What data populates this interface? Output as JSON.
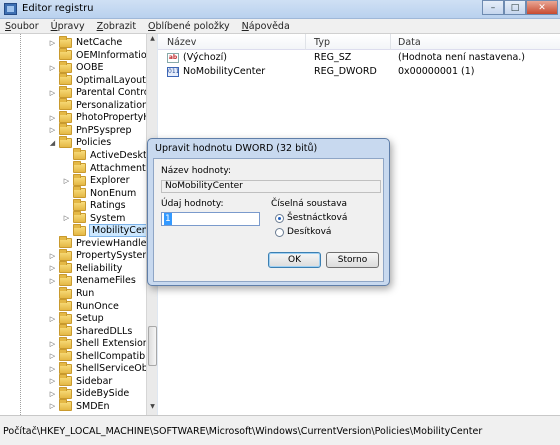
{
  "window": {
    "title": "Editor registru",
    "minimize": "–",
    "maximize": "□",
    "close": "✕"
  },
  "menu": [
    "Soubor",
    "Úpravy",
    "Zobrazit",
    "Oblíbené položky",
    "Nápověda"
  ],
  "tree": [
    {
      "label": "NetCache",
      "indent": 1,
      "expander": "▷"
    },
    {
      "label": "OEMInformation",
      "indent": 1,
      "expander": ""
    },
    {
      "label": "OOBE",
      "indent": 1,
      "expander": "▷"
    },
    {
      "label": "OptimalLayout",
      "indent": 1,
      "expander": ""
    },
    {
      "label": "Parental Controls",
      "indent": 1,
      "expander": "▷"
    },
    {
      "label": "Personalization",
      "indent": 1,
      "expander": ""
    },
    {
      "label": "PhotoPropertyHand",
      "indent": 1,
      "expander": "▷"
    },
    {
      "label": "PnPSysprep",
      "indent": 1,
      "expander": "▷"
    },
    {
      "label": "Policies",
      "indent": 1,
      "expander": "◢"
    },
    {
      "label": "ActiveDesktop",
      "indent": 2,
      "expander": ""
    },
    {
      "label": "Attachments",
      "indent": 2,
      "expander": ""
    },
    {
      "label": "Explorer",
      "indent": 2,
      "expander": "▷"
    },
    {
      "label": "NonEnum",
      "indent": 2,
      "expander": ""
    },
    {
      "label": "Ratings",
      "indent": 2,
      "expander": ""
    },
    {
      "label": "System",
      "indent": 2,
      "expander": "▷"
    },
    {
      "label": "MobilityCenter",
      "indent": 2,
      "expander": "",
      "selected": true
    },
    {
      "label": "PreviewHandlers",
      "indent": 1,
      "expander": ""
    },
    {
      "label": "PropertySystem",
      "indent": 1,
      "expander": "▷"
    },
    {
      "label": "Reliability",
      "indent": 1,
      "expander": "▷"
    },
    {
      "label": "RenameFiles",
      "indent": 1,
      "expander": "▷"
    },
    {
      "label": "Run",
      "indent": 1,
      "expander": ""
    },
    {
      "label": "RunOnce",
      "indent": 1,
      "expander": ""
    },
    {
      "label": "Setup",
      "indent": 1,
      "expander": "▷"
    },
    {
      "label": "SharedDLLs",
      "indent": 1,
      "expander": ""
    },
    {
      "label": "Shell Extensions",
      "indent": 1,
      "expander": "▷"
    },
    {
      "label": "ShellCompatibility",
      "indent": 1,
      "expander": "▷"
    },
    {
      "label": "ShellServiceObjectD",
      "indent": 1,
      "expander": "▷"
    },
    {
      "label": "Sidebar",
      "indent": 1,
      "expander": "▷"
    },
    {
      "label": "SideBySide",
      "indent": 1,
      "expander": "▷"
    },
    {
      "label": "SMDEn",
      "indent": 1,
      "expander": "▷"
    }
  ],
  "list": {
    "columns": [
      "Název",
      "Typ",
      "Data"
    ],
    "rows": [
      {
        "icon": "string-value-icon",
        "icon_text": "ab",
        "name": "(Výchozí)",
        "type": "REG_SZ",
        "data": "(Hodnota není nastavena.)"
      },
      {
        "icon": "dword-value-icon",
        "icon_text": "011",
        "name": "NoMobilityCenter",
        "type": "REG_DWORD",
        "data": "0x00000001 (1)"
      }
    ]
  },
  "status": "Počítač\\HKEY_LOCAL_MACHINE\\SOFTWARE\\Microsoft\\Windows\\CurrentVersion\\Policies\\MobilityCenter",
  "dialog": {
    "title": "Upravit hodnotu DWORD (32 bitů)",
    "name_label": "Název hodnoty:",
    "name_value": "NoMobilityCenter",
    "data_label": "Údaj hodnoty:",
    "data_value": "1",
    "base_label": "Číselná soustava",
    "radio_hex": "Šestnáctková",
    "radio_dec": "Desítková",
    "selected_base": "hex",
    "ok": "OK",
    "cancel": "Storno"
  }
}
